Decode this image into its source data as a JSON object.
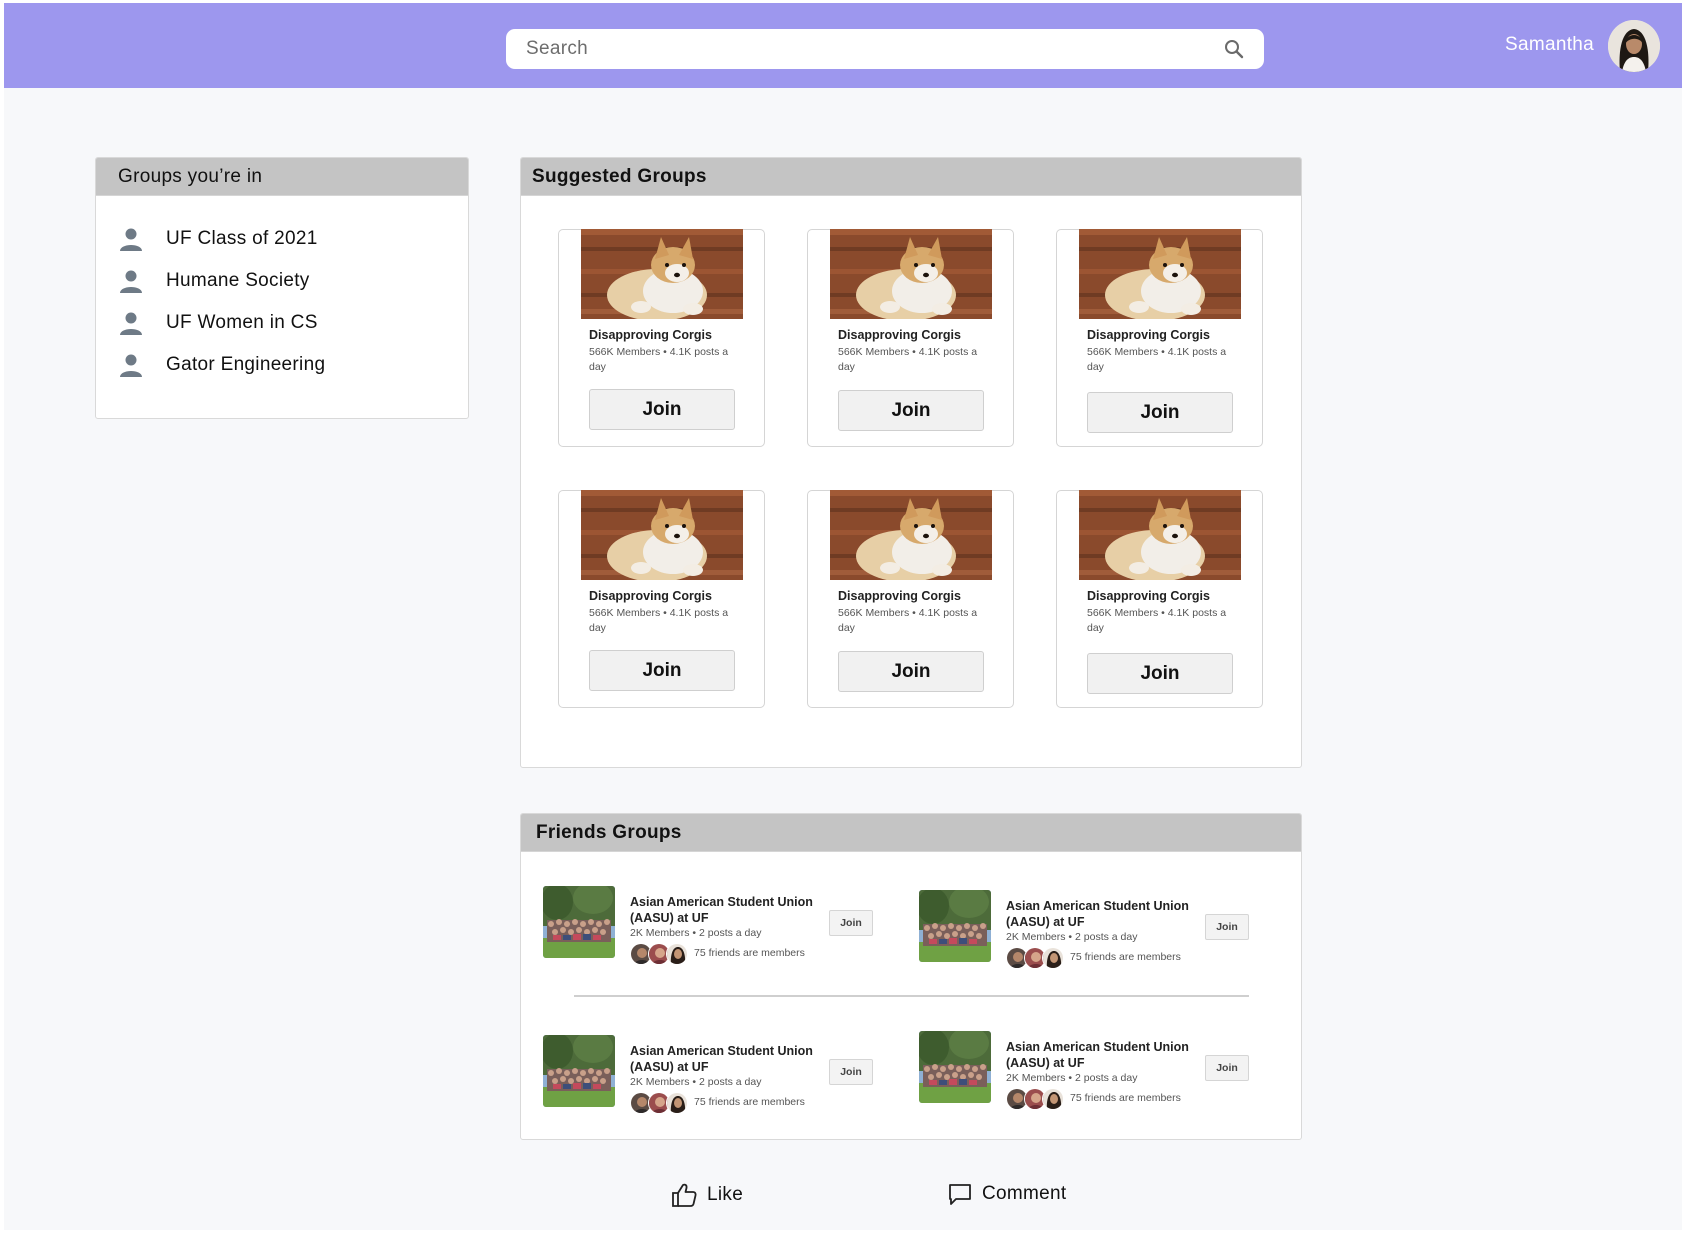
{
  "header": {
    "search_placeholder": "Search",
    "user_name": "Samantha"
  },
  "my_groups": {
    "title": "Groups you’re in",
    "items": [
      {
        "label": "UF Class of 2021"
      },
      {
        "label": "Humane Society"
      },
      {
        "label": "UF Women in CS"
      },
      {
        "label": "Gator Engineering"
      }
    ]
  },
  "suggested": {
    "title": "Suggested Groups",
    "cards": [
      {
        "name": "Disapproving Corgis",
        "meta": "566K Members • 4.1K posts a day",
        "join_label": "Join"
      },
      {
        "name": "Disapproving Corgis",
        "meta": "566K Members • 4.1K posts a day",
        "join_label": "Join"
      },
      {
        "name": "Disapproving Corgis",
        "meta": "566K Members • 4.1K posts a day",
        "join_label": "Join"
      },
      {
        "name": "Disapproving Corgis",
        "meta": "566K Members • 4.1K posts a day",
        "join_label": "Join"
      },
      {
        "name": "Disapproving Corgis",
        "meta": "566K Members • 4.1K posts a day",
        "join_label": "Join"
      },
      {
        "name": "Disapproving Corgis",
        "meta": "566K Members • 4.1K posts a day",
        "join_label": "Join"
      }
    ]
  },
  "friends_groups": {
    "title": "Friends Groups",
    "items": [
      {
        "name": "Asian American Student Union (AASU) at UF",
        "meta": "2K Members • 2 posts a day",
        "friends": "75 friends are members",
        "join_label": "Join"
      },
      {
        "name": "Asian American Student Union (AASU) at UF",
        "meta": "2K Members • 2 posts a day",
        "friends": "75 friends are members",
        "join_label": "Join"
      },
      {
        "name": "Asian American Student Union (AASU) at UF",
        "meta": "2K Members • 2 posts a day",
        "friends": "75 friends are members",
        "join_label": "Join"
      },
      {
        "name": "Asian American Student Union (AASU) at UF",
        "meta": "2K Members • 2 posts a day",
        "friends": "75 friends are members",
        "join_label": "Join"
      }
    ]
  },
  "actions": {
    "like_label": "Like",
    "comment_label": "Comment"
  },
  "colors": {
    "topbar": "#9d97ee",
    "panel_header": "#c4c4c4",
    "page_bg": "#f7f8fa",
    "person_icon": "#6e7a86"
  },
  "icons": {
    "search": "search-icon",
    "person": "person-icon",
    "like": "thumbs-up-icon",
    "comment": "comment-icon"
  }
}
